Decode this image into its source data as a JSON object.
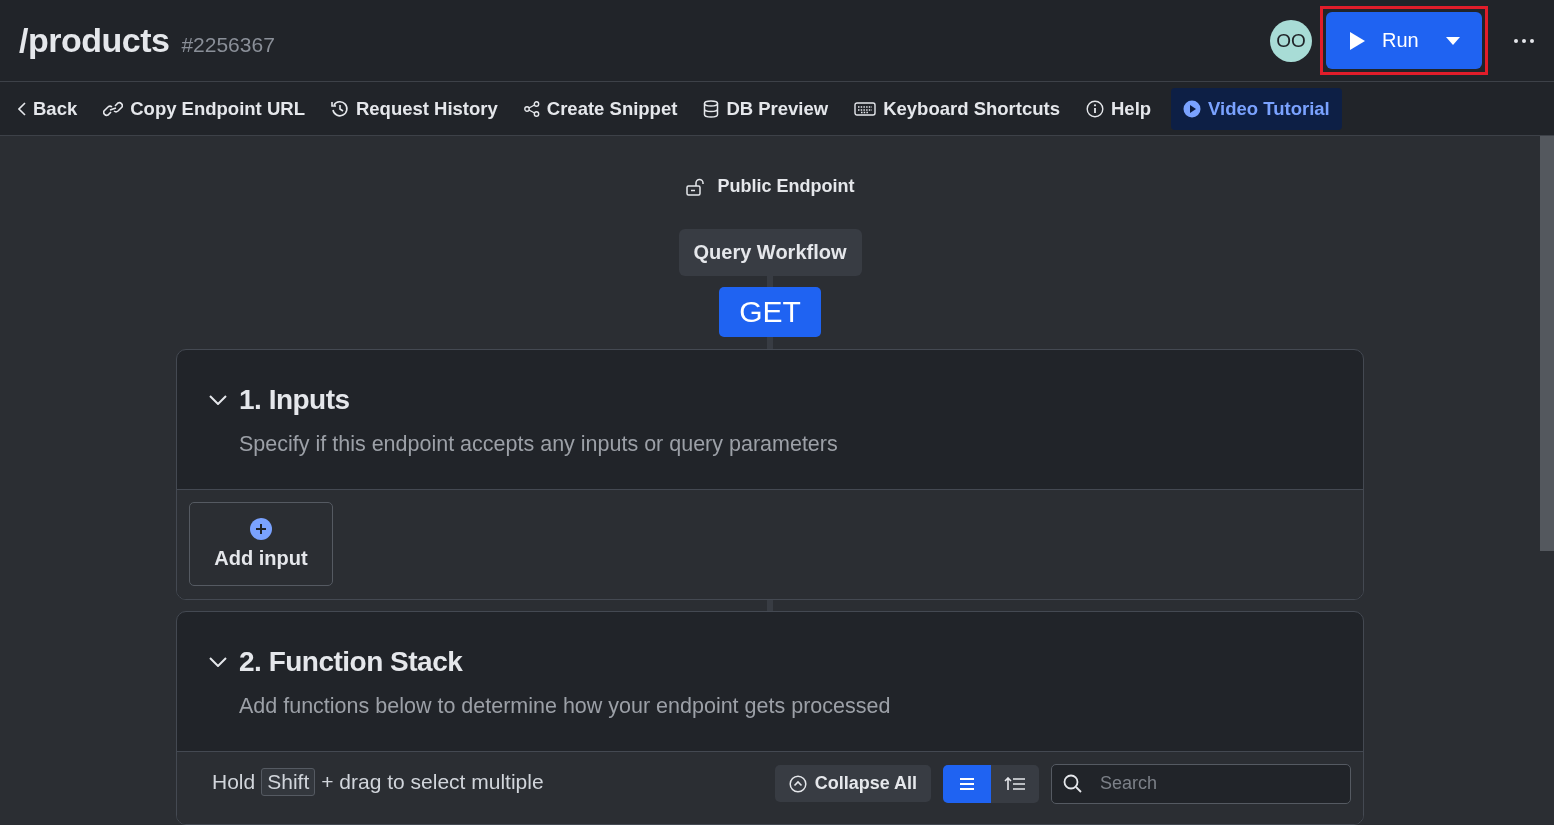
{
  "header": {
    "title": "/products",
    "id": "#2256367",
    "avatar": "OO",
    "run_button": {
      "label": "Run",
      "highlighted": true
    }
  },
  "toolbar": [
    {
      "kind": "back",
      "label": "Back",
      "accent": false
    },
    {
      "kind": "link",
      "label": "Copy Endpoint URL",
      "accent": false
    },
    {
      "kind": "history",
      "label": "Request History",
      "accent": false
    },
    {
      "kind": "share",
      "label": "Create Snippet",
      "accent": false
    },
    {
      "kind": "database",
      "label": "DB Preview",
      "accent": false
    },
    {
      "kind": "keyboard",
      "label": "Keyboard Shortcuts",
      "accent": false
    },
    {
      "kind": "info",
      "label": "Help",
      "accent": false
    },
    {
      "kind": "video",
      "label": "Video Tutorial",
      "accent": true
    }
  ],
  "access": "Public Endpoint",
  "workflow": "Query Workflow",
  "method": "GET",
  "sections": [
    {
      "title": "1. Inputs",
      "description": "Specify if this endpoint accepts any inputs or query parameters",
      "expanded": true,
      "kind": "inputs",
      "add_button": "Add input"
    },
    {
      "title": "2. Function Stack",
      "description": "Add functions below to determine how your endpoint gets processed",
      "expanded": true,
      "kind": "functions",
      "hint_before": "Hold",
      "key": "Shift",
      "hint_after": "+ drag to select multiple",
      "collapse_button": "Collapse All",
      "search": {
        "placeholder": "Search"
      }
    }
  ]
}
